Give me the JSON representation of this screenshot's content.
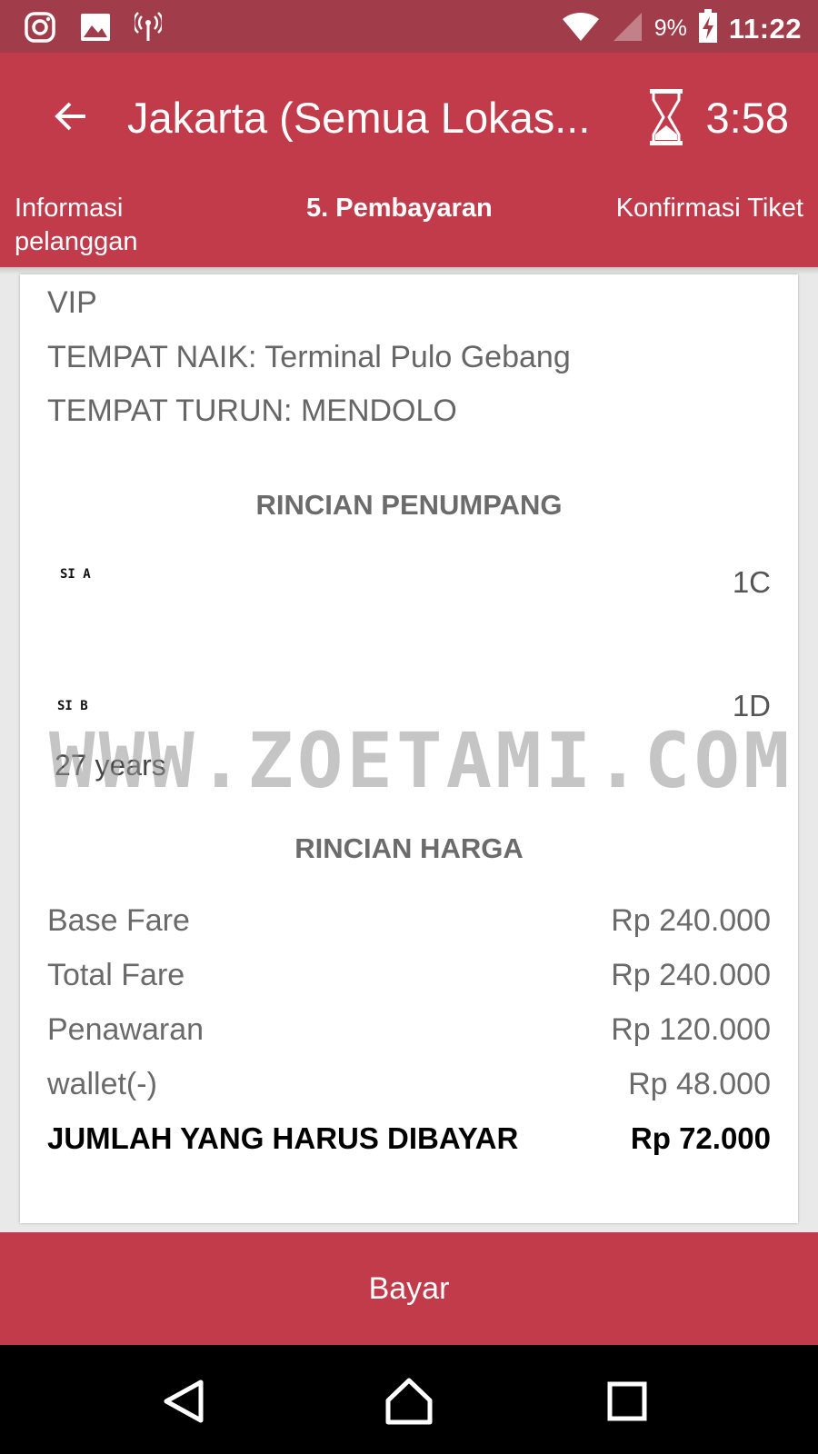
{
  "status_bar": {
    "battery_percent": "9%",
    "time": "11:22",
    "icons": [
      "instagram-icon",
      "gallery-icon",
      "antenna-icon",
      "wifi-icon",
      "signal-icon",
      "battery-charging-icon"
    ]
  },
  "app_bar": {
    "title": "Jakarta (Semua Lokas...",
    "timer": "3:58"
  },
  "steps": {
    "step_1": "Informasi pelanggan",
    "step_2": "5. Pembayaran",
    "step_3": "Konfirmasi Tiket"
  },
  "trip": {
    "bus_class": "VIP",
    "boarding": "TEMPAT NAIK: Terminal Pulo Gebang",
    "dropping": "TEMPAT TURUN: MENDOLO"
  },
  "passengers": {
    "title": "RINCIAN PENUMPANG",
    "list": [
      {
        "name": "SI A",
        "seat": "1C"
      },
      {
        "name": "SI B",
        "seat": "1D",
        "age": "27 years"
      }
    ]
  },
  "watermark": "WWW.ZOETAMI.COM",
  "pricing": {
    "title": "RINCIAN HARGA",
    "rows": [
      {
        "label": "Base Fare",
        "value": "Rp 240.000"
      },
      {
        "label": "Total Fare",
        "value": "Rp 240.000"
      },
      {
        "label": "Penawaran",
        "value": "Rp 120.000"
      },
      {
        "label": "wallet(-)",
        "value": "Rp 48.000"
      }
    ],
    "total": {
      "label": "JUMLAH YANG HARUS DIBAYAR",
      "value": "Rp 72.000"
    }
  },
  "pay_button": "Bayar",
  "colors": {
    "status_bar": "#a13c4a",
    "primary": "#c13b4b",
    "nav_bar": "#000000"
  }
}
